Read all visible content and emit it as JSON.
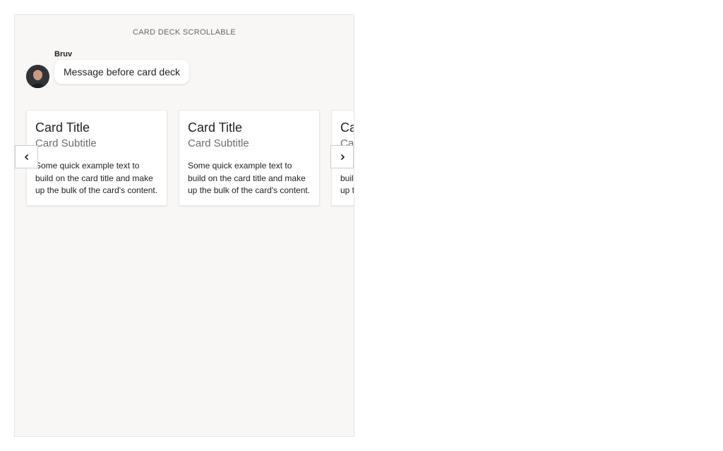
{
  "panel": {
    "title": "CARD DECK SCROLLABLE"
  },
  "message": {
    "sender": "Bruv",
    "text": "Message before card deck",
    "avatar_icon": "user-avatar"
  },
  "cards": [
    {
      "title": "Card Title",
      "subtitle": "Card Subtitle",
      "text": "Some quick example text to build on the card title and make up the bulk of the card's content."
    },
    {
      "title": "Card Title",
      "subtitle": "Card Subtitle",
      "text": "Some quick example text to build on the card title and make up the bulk of the card's content."
    },
    {
      "title": "Card Title",
      "subtitle": "Card Subtitle",
      "text": "Some quick example text to build on the card title and make up the bulk of the card's content."
    }
  ],
  "navigation": {
    "prev_icon": "chevron-left-icon",
    "next_icon": "chevron-right-icon"
  },
  "colors": {
    "panel_background": "#f8f7f5",
    "bubble_background": "#ffffff",
    "subtitle_text": "#6c6c6c"
  }
}
